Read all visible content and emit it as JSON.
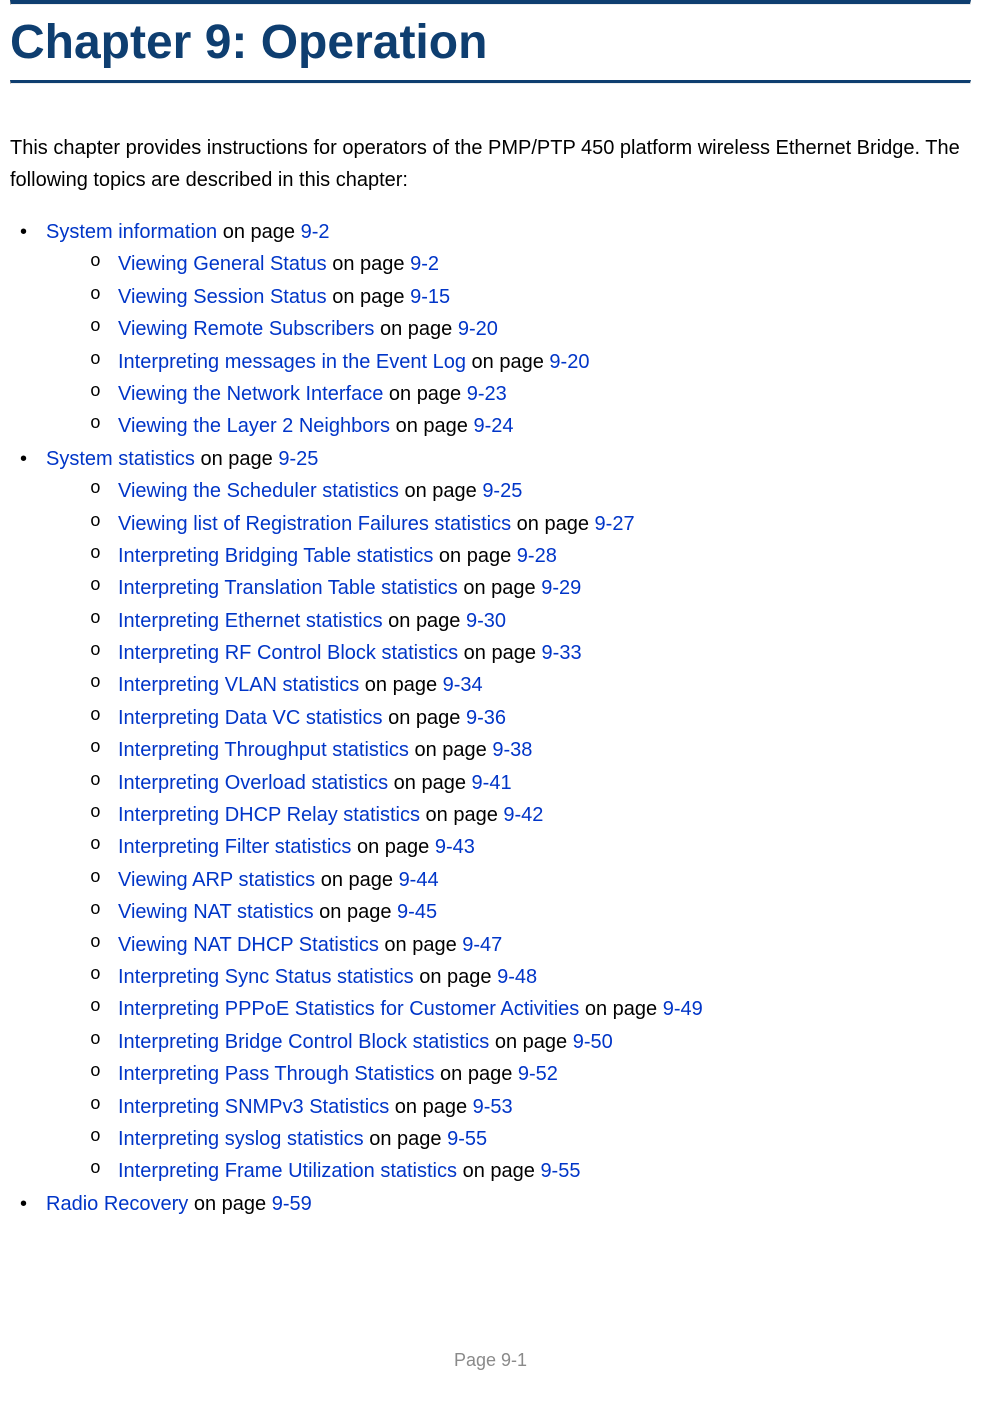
{
  "chapter_title": "Chapter 9:  Operation",
  "intro": "This chapter provides instructions for operators of the PMP/PTP 450 platform wireless Ethernet Bridge. The following topics are described in this chapter:",
  "on_page_text": " on page ",
  "sections": [
    {
      "link": "System information",
      "page": "9-2",
      "children": [
        {
          "link": "Viewing General Status",
          "page": "9-2"
        },
        {
          "link": "Viewing Session Status",
          "page": "9-15"
        },
        {
          "link": "Viewing Remote Subscribers",
          "page": "9-20"
        },
        {
          "link": "Interpreting messages in the Event Log",
          "page": "9-20"
        },
        {
          "link": "Viewing the Network Interface",
          "page": "9-23"
        },
        {
          "link": "Viewing the Layer 2 Neighbors",
          "page": "9-24"
        }
      ]
    },
    {
      "link": "System statistics",
      "page": "9-25",
      "children": [
        {
          "link": "Viewing the Scheduler statistics",
          "page": "9-25"
        },
        {
          "link": "Viewing list of Registration Failures statistics",
          "page": "9-27"
        },
        {
          "link": "Interpreting Bridging Table statistics",
          "page": "9-28"
        },
        {
          "link": "Interpreting Translation Table statistics",
          "page": "9-29"
        },
        {
          "link": "Interpreting Ethernet statistics",
          "page": "9-30"
        },
        {
          "link": "Interpreting RF Control Block statistics",
          "page": "9-33"
        },
        {
          "link": "Interpreting VLAN statistics",
          "page": "9-34"
        },
        {
          "link": "Interpreting Data VC statistics",
          "page": "9-36"
        },
        {
          "link": "Interpreting Throughput statistics",
          "page": "9-38"
        },
        {
          "link": "Interpreting Overload statistics",
          "page": "9-41"
        },
        {
          "link": "Interpreting DHCP Relay statistics",
          "page": "9-42"
        },
        {
          "link": "Interpreting Filter statistics",
          "page": "9-43"
        },
        {
          "link": "Viewing ARP statistics",
          "page": "9-44"
        },
        {
          "link": "Viewing NAT statistics",
          "page": "9-45"
        },
        {
          "link": "Viewing NAT DHCP Statistics",
          "page": "9-47"
        },
        {
          "link": "Interpreting Sync Status statistics",
          "page": "9-48"
        },
        {
          "link": "Interpreting PPPoE Statistics for Customer Activities",
          "page": "9-49"
        },
        {
          "link": "Interpreting Bridge Control Block statistics",
          "page": "9-50"
        },
        {
          "link": "Interpreting Pass Through Statistics",
          "page": "9-52"
        },
        {
          "link": "Interpreting SNMPv3 Statistics",
          "page": "9-53"
        },
        {
          "link": "Interpreting syslog statistics",
          "page": "9-55"
        },
        {
          "link": "Interpreting Frame Utilization statistics",
          "page": "9-55"
        }
      ]
    },
    {
      "link": "Radio Recovery ",
      "page": "9-59",
      "children": []
    }
  ],
  "footer": "Page 9-1"
}
